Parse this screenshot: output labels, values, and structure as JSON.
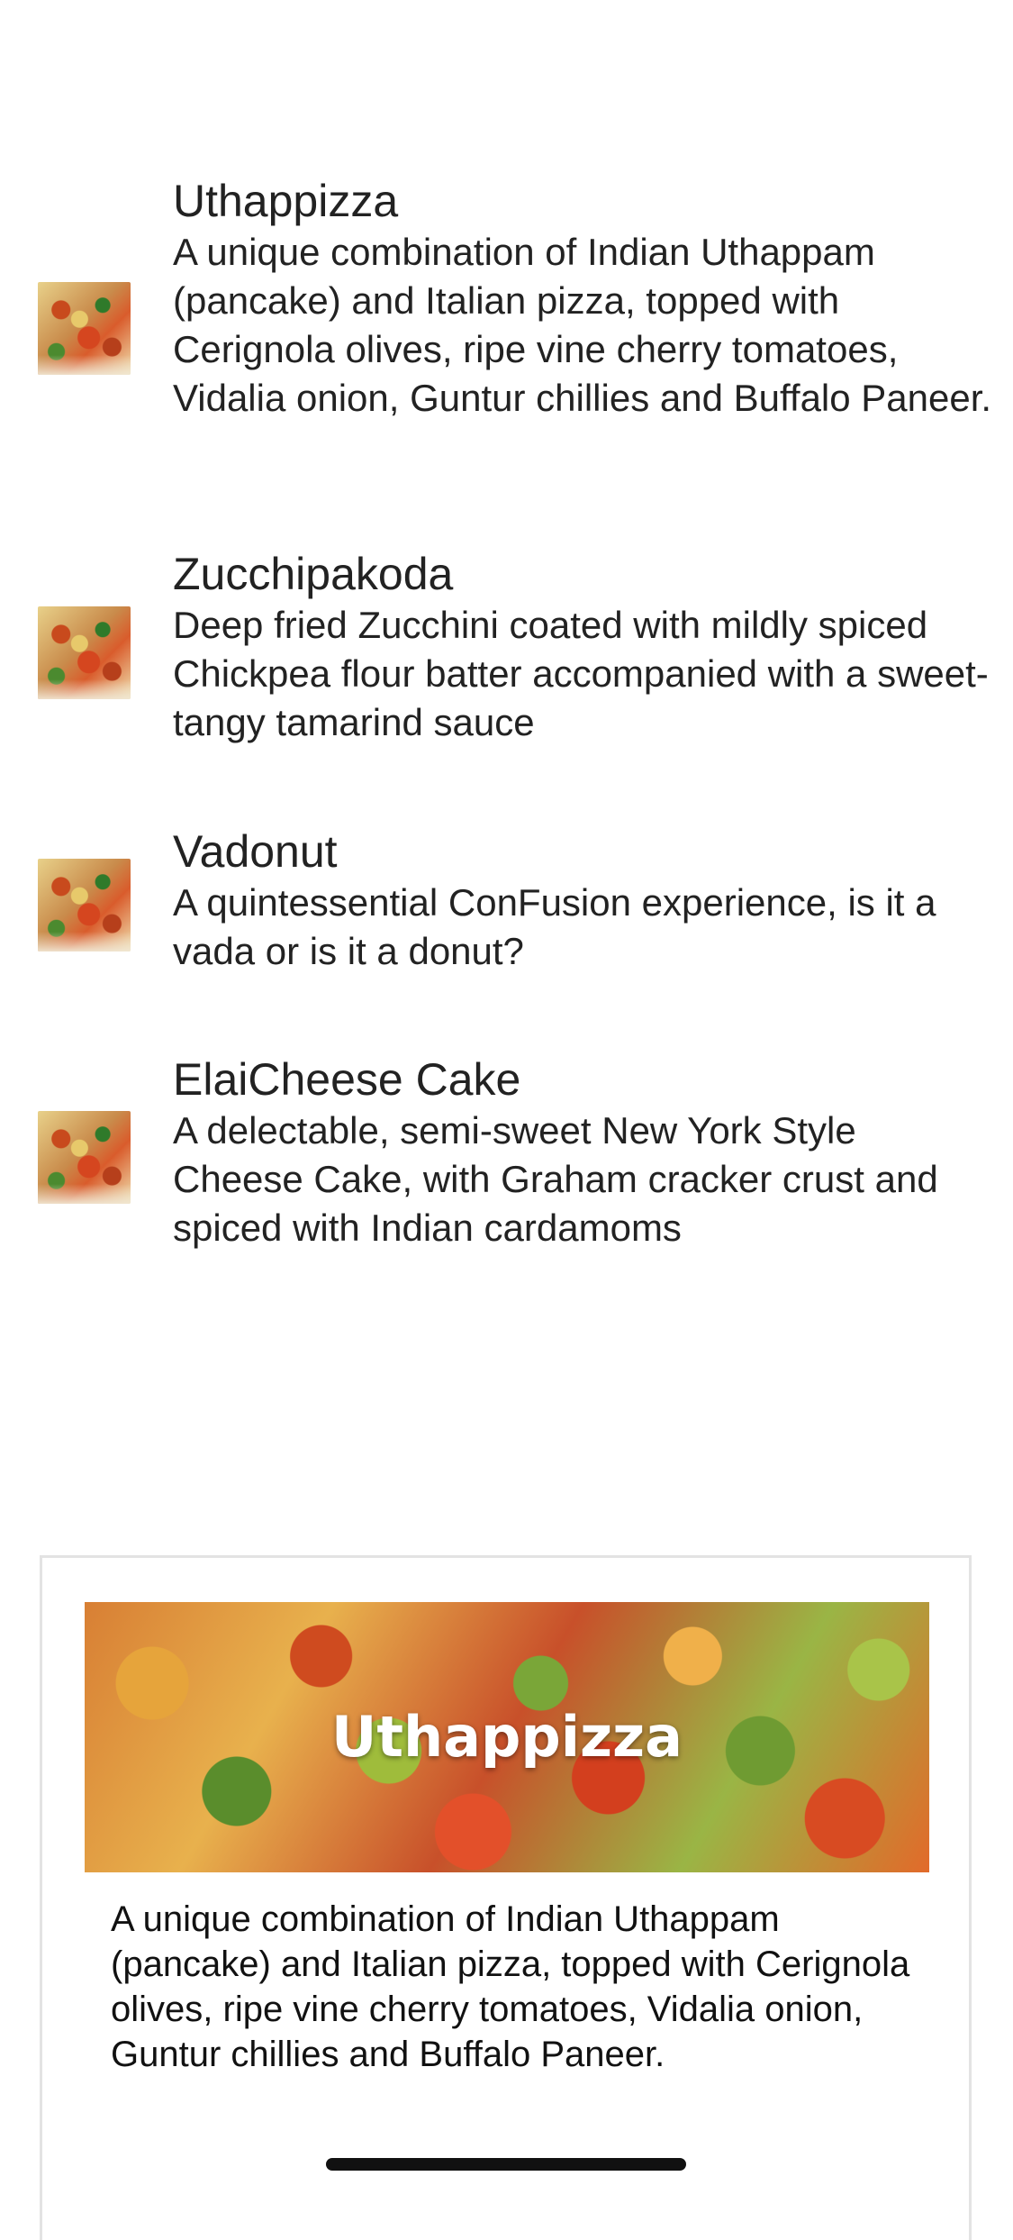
{
  "menu": {
    "items": [
      {
        "title": "Uthappizza",
        "description": "A unique combination of Indian Uthappam (pancake) and Italian pizza, topped with Cerignola olives, ripe vine cherry tomatoes, Vidalia onion, Guntur chillies and Buffalo Paneer.",
        "thumbnail_icon": "pizza-thumbnail"
      },
      {
        "title": "Zucchipakoda",
        "description": "Deep fried Zucchini coated with mildly spiced Chickpea flour batter accompanied with a sweet-tangy tamarind sauce",
        "thumbnail_icon": "pizza-thumbnail"
      },
      {
        "title": "Vadonut",
        "description": "A quintessential ConFusion experience, is it a vada or is it a donut?",
        "thumbnail_icon": "pizza-thumbnail"
      },
      {
        "title": "ElaiCheese Cake",
        "description": "A delectable, semi-sweet New York Style Cheese Cake, with Graham cracker crust and spiced with Indian cardamoms",
        "thumbnail_icon": "pizza-thumbnail"
      }
    ]
  },
  "featured": {
    "title": "Uthappizza",
    "description": "A unique combination of Indian Uthappam (pancake) and Italian pizza, topped with Cerignola olives, ripe vine cherry tomatoes, Vidalia onion, Guntur chillies and Buffalo Paneer."
  }
}
